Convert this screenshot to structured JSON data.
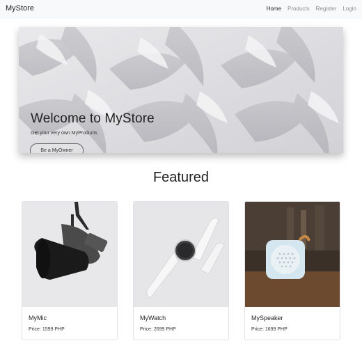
{
  "navbar": {
    "brand": "MyStore",
    "links": [
      {
        "label": "Home",
        "active": true
      },
      {
        "label": "Products",
        "active": false
      },
      {
        "label": "Register",
        "active": false
      },
      {
        "label": "Login",
        "active": false
      }
    ]
  },
  "hero": {
    "title": "Welcome to MyStore",
    "subtitle": "Get your very own MyProducts",
    "button_label": "Be a MyOwner"
  },
  "featured": {
    "heading": "Featured",
    "products": [
      {
        "name": "MyMic",
        "price": "Price: 1599 PHP",
        "image_icon": "microphone-icon"
      },
      {
        "name": "MyWatch",
        "price": "Price: 2699 PHP",
        "image_icon": "smartwatch-icon"
      },
      {
        "name": "MySpeaker",
        "price": "Price: 1699 PHP",
        "image_icon": "speaker-icon"
      }
    ]
  }
}
